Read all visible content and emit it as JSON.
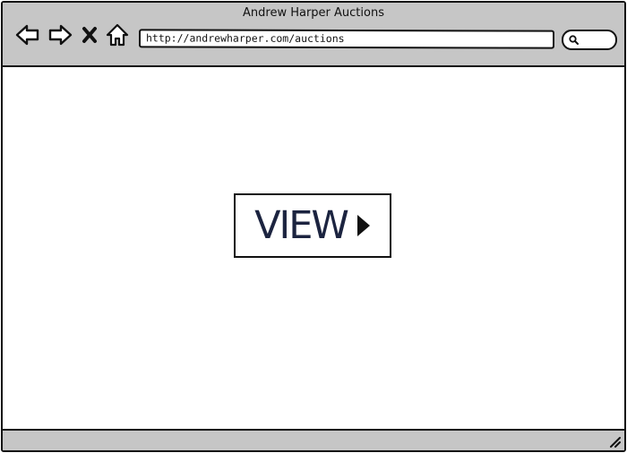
{
  "window": {
    "title": "Andrew Harper Auctions"
  },
  "toolbar": {
    "back_icon": "back-arrow-icon",
    "forward_icon": "forward-arrow-icon",
    "stop_icon": "close-icon",
    "home_icon": "home-icon",
    "search_icon": "search-icon"
  },
  "address_bar": {
    "url": "http://andrewharper.com/auctions"
  },
  "main": {
    "view_button_label": "VIEW",
    "view_button_icon": "play-triangle-icon"
  },
  "colors": {
    "chrome_gray": "#c6c6c6",
    "outline": "#111111",
    "button_text": "#1c2440"
  }
}
